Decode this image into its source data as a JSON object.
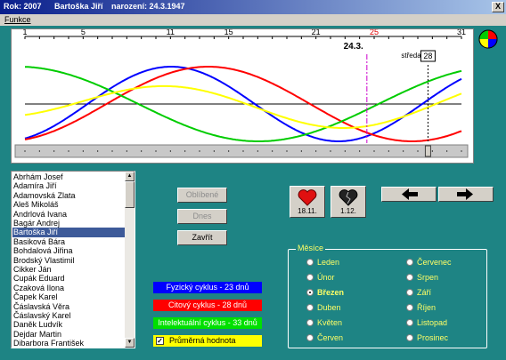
{
  "window": {
    "title_year": "Rok: 2007",
    "title_name": "Bartoška Jiří",
    "title_birth": "narození: 24.3.1947",
    "close_label": "X"
  },
  "menu": {
    "items": [
      "Funkce"
    ]
  },
  "graph": {
    "ruler_labels": [
      "1",
      "5",
      "11",
      "15",
      "21",
      "25",
      "31"
    ],
    "ruler_days": [
      1,
      5,
      11,
      15,
      21,
      25,
      31
    ],
    "highlight_day": "25",
    "birthday_label": "24.3.",
    "weekday_label": "středa",
    "selected_day": "28",
    "colors": {
      "physical": "#0000ff",
      "emotional": "#ff0000",
      "intellectual": "#00cc00",
      "average": "#ffff00"
    }
  },
  "people": [
    "Abrhám Josef",
    "Adamíra Jiří",
    "Adamovská Zlata",
    "Aleš Mikoláš",
    "Andrlová Ivana",
    "Bagár Andrej",
    "Bartoška Jiří",
    "Basiková Bára",
    "Bohdalová Jiřina",
    "Brodský Vlastimil",
    "Cikker Ján",
    "Cupák Eduard",
    "Czaková Ilona",
    "Čapek Karel",
    "Čáslavská Věra",
    "Čáslavský Karel",
    "Daněk Ludvík",
    "Dejdar Martin",
    "Dibarbora František"
  ],
  "selected_person_index": 6,
  "buttons": {
    "favorite": "Oblíbené",
    "today": "Dnes",
    "close": "Zavřít"
  },
  "critical_days": {
    "good": "18.11.",
    "bad": "1.12."
  },
  "legend": {
    "physical": "Fyzický cyklus - 23 dnů",
    "emotional": "Citový cyklus - 28 dnů",
    "intellectual": "Intelektuální cyklus - 33 dnů",
    "average": "Průměrná hodnota"
  },
  "months": {
    "group_label": "Měsíce",
    "items": [
      "Leden",
      "Únor",
      "Březen",
      "Duben",
      "Květen",
      "Červen",
      "Červenec",
      "Srpen",
      "Září",
      "Říjen",
      "Listopad",
      "Prosinec"
    ],
    "selected": "Březen"
  }
}
